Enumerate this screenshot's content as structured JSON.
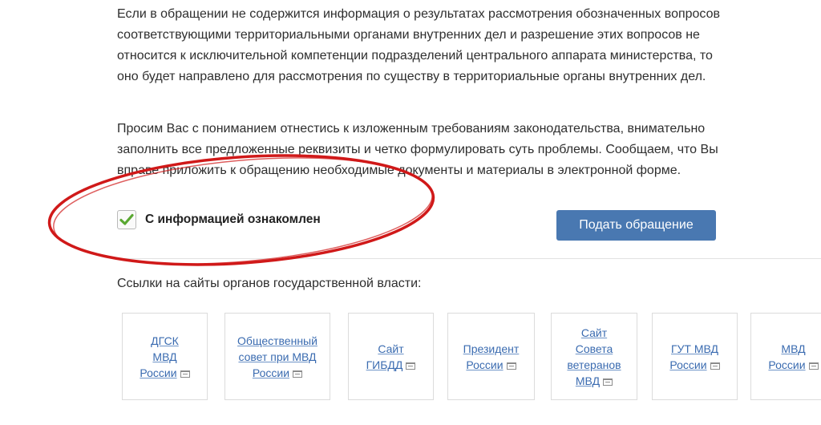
{
  "intro": {
    "paragraph1": "Если в обращении не содержится информация о результатах рассмотрения обозначенных вопросов соответствующими территориальными органами внутренних дел и разрешение этих вопросов не относится к исключительной компетенции подразделений центрального аппарата министерства, то оно будет направлено для рассмотрения по существу в территориальные органы внутренних дел.",
    "paragraph2": "Просим Вас с пониманием отнестись к изложенным требованиям законодательства, внимательно заполнить все предложенные реквизиты и четко формулировать суть проблемы. Сообщаем, что Вы вправе приложить к обращению необходимые документы и материалы в электронной форме."
  },
  "consent": {
    "checked": true,
    "label": "С информацией ознакомлен"
  },
  "submit_button": {
    "label": "Подать обращение",
    "color": "#4978b1"
  },
  "links_section": {
    "title": "Ссылки на сайты органов государственной власти:",
    "links": [
      {
        "label": "ДГСК МВД России"
      },
      {
        "label": "Общественный совет при МВД России"
      },
      {
        "label": "Сайт ГИБДД"
      },
      {
        "label": "Президент России"
      },
      {
        "label": "Сайт Совета ветеранов МВД"
      },
      {
        "label": "ГУТ МВД России"
      },
      {
        "label": "МВД России"
      }
    ]
  },
  "annotation": {
    "shape": "ellipse",
    "color": "#d01919"
  },
  "colors": {
    "link": "#3a6bb0",
    "check": "#5aa832"
  }
}
